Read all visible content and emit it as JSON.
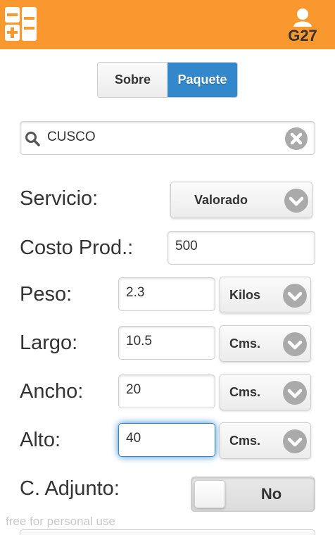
{
  "header": {
    "menu_icon": "calculator-icon",
    "user_icon": "user-icon",
    "user_label": "G27",
    "bar_color": "#f9982e"
  },
  "segmented": {
    "options": [
      "Sobre",
      "Paquete"
    ],
    "selected": "Paquete",
    "active_color": "#3388cc"
  },
  "search": {
    "value": "CUSCO",
    "search_icon": "search-icon",
    "clear_icon": "clear-icon"
  },
  "form": {
    "servicio": {
      "label": "Servicio:",
      "value": "Valorado"
    },
    "costo": {
      "label": "Costo Prod.:",
      "value": "500"
    },
    "peso": {
      "label": "Peso:",
      "value": "2.3",
      "unit": "Kilos"
    },
    "largo": {
      "label": "Largo:",
      "value": "10.5",
      "unit": "Cms."
    },
    "ancho": {
      "label": "Ancho:",
      "value": "20",
      "unit": "Cms."
    },
    "alto": {
      "label": "Alto:",
      "value": "40",
      "unit": "Cms."
    },
    "adjunto": {
      "label": "C. Adjunto:",
      "value": "No"
    }
  },
  "watermark": "free for personal use"
}
